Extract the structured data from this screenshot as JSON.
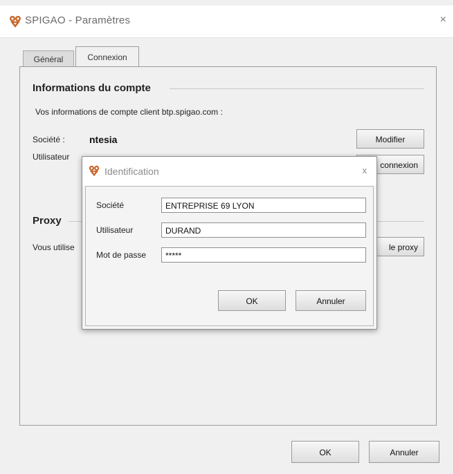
{
  "window": {
    "title": "SPIGAO - Paramètres",
    "close_icon": "×"
  },
  "tabs": [
    {
      "label": "Général",
      "active": false
    },
    {
      "label": "Connexion",
      "active": true
    }
  ],
  "account": {
    "section_title": "Informations du compte",
    "description": "Vos informations de compte client btp.spigao.com :",
    "societe_label": "Société :",
    "societe_value": "ntesia",
    "utilisateur_label": "Utilisateur",
    "modify_button": "Modifier",
    "connexion_button": "connexion"
  },
  "proxy": {
    "section_title": "Proxy",
    "description_partial": "Vous utilise",
    "proxy_button": "le proxy"
  },
  "footer": {
    "ok": "OK",
    "cancel": "Annuler"
  },
  "dialog": {
    "title": "Identification",
    "close_icon": "x",
    "societe_label": "Société",
    "societe_value": "ENTREPRISE 69 LYON",
    "utilisateur_label": "Utilisateur",
    "utilisateur_value": "DURAND",
    "password_label": "Mot de passe",
    "password_value": "*****",
    "ok": "OK",
    "cancel": "Annuler"
  },
  "colors": {
    "window_bg": "#f0f0f0",
    "title_text": "#6a6a6a",
    "logo_orange": "#c8662a"
  },
  "icons": {
    "app_logo": "spigao-logo-icon"
  }
}
